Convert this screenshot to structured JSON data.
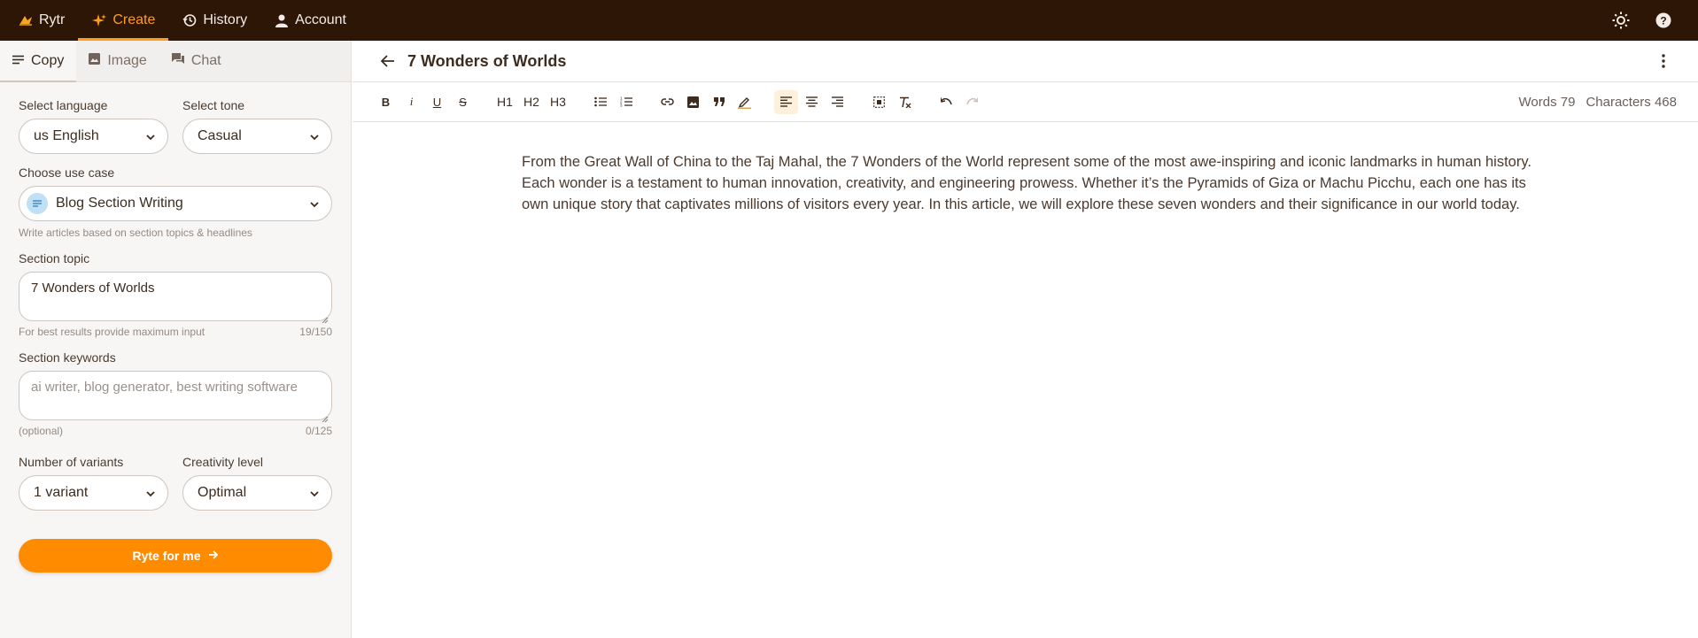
{
  "topnav": {
    "brand": "Rytr",
    "items": [
      {
        "label": "Create",
        "icon": "sparkle-icon",
        "active": true
      },
      {
        "label": "History",
        "icon": "history-icon",
        "active": false
      },
      {
        "label": "Account",
        "icon": "user-icon",
        "active": false
      }
    ],
    "right_icons": [
      "sun-icon",
      "help-icon"
    ]
  },
  "sidebar": {
    "tabs": [
      {
        "label": "Copy",
        "icon": "lines-icon",
        "active": true
      },
      {
        "label": "Image",
        "icon": "image-icon",
        "active": false
      },
      {
        "label": "Chat",
        "icon": "chat-icon",
        "active": false
      }
    ],
    "language": {
      "label": "Select language",
      "value": "us English"
    },
    "tone": {
      "label": "Select tone",
      "value": "Casual"
    },
    "usecase": {
      "label": "Choose use case",
      "value": "Blog Section Writing",
      "hint": "Write articles based on section topics & headlines"
    },
    "topic": {
      "label": "Section topic",
      "value": "7 Wonders of Worlds",
      "hint": "For best results provide maximum input",
      "count": "19/150"
    },
    "keywords": {
      "label": "Section keywords",
      "placeholder": "ai writer, blog generator, best writing software",
      "hint": "(optional)",
      "count": "0/125"
    },
    "variants": {
      "label": "Number of variants",
      "value": "1 variant"
    },
    "creativity": {
      "label": "Creativity level",
      "value": "Optimal"
    },
    "cta": "Ryte for me"
  },
  "editor": {
    "title": "7 Wonders of Worlds",
    "toolbar": {
      "bold": "B",
      "italic": "i",
      "underline": "U",
      "strike": "S",
      "h1": "H1",
      "h2": "H2",
      "h3": "H3"
    },
    "words_label": "Words 79",
    "chars_label": "Characters 468",
    "body": "From the Great Wall of China to the Taj Mahal, the 7 Wonders of the World represent some of the most awe-inspiring and iconic landmarks in human history. Each wonder is a testament to human innovation, creativity, and engineering prowess. Whether it’s the Pyramids of Giza or Machu Picchu, each one has its own unique story that captivates millions of visitors every year. In this article, we will explore these seven wonders and their significance in our world today."
  },
  "colors": {
    "topbar": "#2d1606",
    "accent": "#ff8c00",
    "active_nav": "#ff9e1b"
  }
}
